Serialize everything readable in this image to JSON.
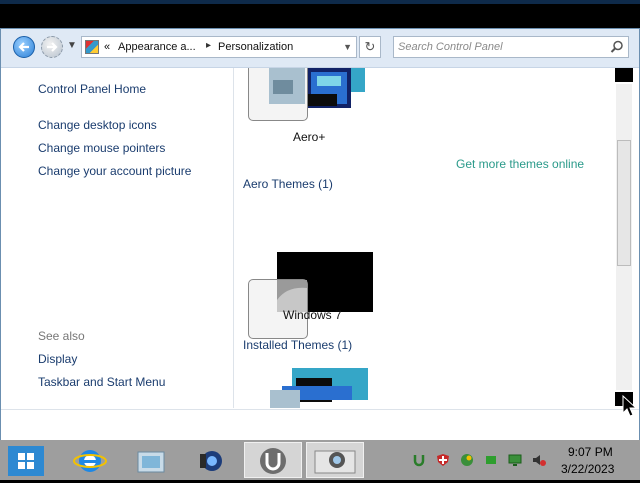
{
  "address_bar": {
    "crumb_overflow": "«",
    "crumb_1": "Appearance a...",
    "crumb_sep": "▸",
    "crumb_2": "Personalization",
    "refresh_glyph": "↻",
    "search_placeholder": "Search Control Panel"
  },
  "sidebar": {
    "home": "Control Panel Home",
    "items": [
      "Change desktop icons",
      "Change mouse pointers",
      "Change your account picture"
    ],
    "see_also": "See also",
    "see_also_items": [
      "Display",
      "Taskbar and Start Menu"
    ]
  },
  "main": {
    "theme_top": "Aero+",
    "get_more_link": "Get more themes online",
    "aero_section": "Aero Themes (1)",
    "theme_windows7": "Windows 7",
    "installed_section": "Installed Themes (1)"
  },
  "taskbar": {
    "time": "9:07 PM",
    "date": "3/22/2023",
    "items": [
      "start-icon",
      "internet-explorer-icon",
      "control-panel-icon",
      "media-icon",
      "utorrent-icon",
      "personalization-icon"
    ]
  },
  "colors": {
    "accent": "#2d89d2",
    "link": "#1a3c6e",
    "online_link": "#2a9a8a"
  }
}
